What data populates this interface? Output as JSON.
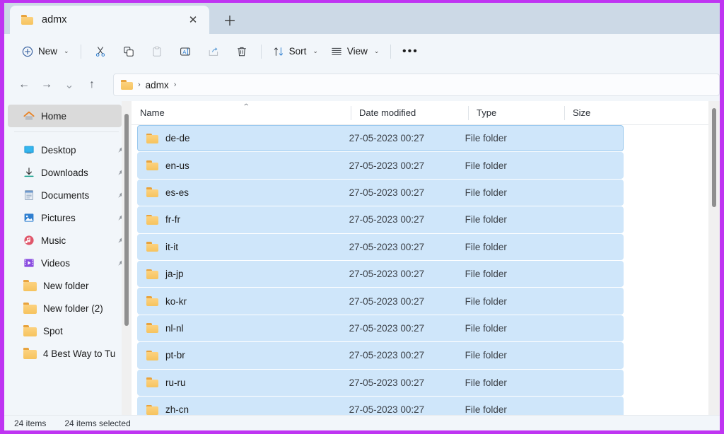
{
  "window": {
    "frame_color": "#bf34f2",
    "titlebar_color": "#ccd9e6",
    "accent_selection": "#cfe6fa"
  },
  "tabbar": {
    "tabs": [
      {
        "label": "admx",
        "icon": "folder-icon",
        "active": true
      }
    ],
    "close_glyph": "✕",
    "newtab_glyph": "＋",
    "newtab_label": "New tab"
  },
  "toolbar": {
    "new_label": "New",
    "new_glyph": "⊕",
    "chevron": "⌄",
    "cut_label": "Cut",
    "copy_label": "Copy",
    "paste_label": "Paste",
    "rename_label": "Rename",
    "share_label": "Share",
    "delete_label": "Delete",
    "sort_label": "Sort",
    "view_label": "View",
    "more_label": "See more",
    "more_glyph": "•••"
  },
  "navbar": {
    "back_glyph": "←",
    "forward_glyph": "→",
    "recent_glyph": "⌄",
    "up_glyph": "↑",
    "breadcrumb": {
      "icon": "folder-icon",
      "sep": "›",
      "items": [
        "admx"
      ],
      "trailing_sep": "›"
    }
  },
  "sidebar": {
    "home": {
      "label": "Home",
      "icon": "home-icon",
      "selected": true
    },
    "items": [
      {
        "label": "Desktop",
        "icon": "desktop-icon",
        "pinned": true
      },
      {
        "label": "Downloads",
        "icon": "download-icon",
        "pinned": true
      },
      {
        "label": "Documents",
        "icon": "document-icon",
        "pinned": true
      },
      {
        "label": "Pictures",
        "icon": "pictures-icon",
        "pinned": true
      },
      {
        "label": "Music",
        "icon": "music-icon",
        "pinned": true
      },
      {
        "label": "Videos",
        "icon": "video-icon",
        "pinned": true
      },
      {
        "label": "New folder",
        "icon": "folder-icon",
        "pinned": false
      },
      {
        "label": "New folder (2)",
        "icon": "folder-icon",
        "pinned": false
      },
      {
        "label": "Spot",
        "icon": "folder-icon",
        "pinned": false
      },
      {
        "label": "4 Best Way to Tu",
        "icon": "folder-icon",
        "pinned": false
      }
    ],
    "pin_glyph": "📌"
  },
  "filepane": {
    "columns": [
      {
        "key": "name",
        "label": "Name",
        "sorted": true,
        "sort_glyph": "⌃"
      },
      {
        "key": "date",
        "label": "Date modified"
      },
      {
        "key": "type",
        "label": "Type"
      },
      {
        "key": "size",
        "label": "Size"
      }
    ],
    "rows": [
      {
        "name": "de-de",
        "date": "27-05-2023 00:27",
        "type": "File folder",
        "size": "",
        "selected": true,
        "focused": true
      },
      {
        "name": "en-us",
        "date": "27-05-2023 00:27",
        "type": "File folder",
        "size": "",
        "selected": true,
        "focused": false
      },
      {
        "name": "es-es",
        "date": "27-05-2023 00:27",
        "type": "File folder",
        "size": "",
        "selected": true,
        "focused": false
      },
      {
        "name": "fr-fr",
        "date": "27-05-2023 00:27",
        "type": "File folder",
        "size": "",
        "selected": true,
        "focused": false
      },
      {
        "name": "it-it",
        "date": "27-05-2023 00:27",
        "type": "File folder",
        "size": "",
        "selected": true,
        "focused": false
      },
      {
        "name": "ja-jp",
        "date": "27-05-2023 00:27",
        "type": "File folder",
        "size": "",
        "selected": true,
        "focused": false
      },
      {
        "name": "ko-kr",
        "date": "27-05-2023 00:27",
        "type": "File folder",
        "size": "",
        "selected": true,
        "focused": false
      },
      {
        "name": "nl-nl",
        "date": "27-05-2023 00:27",
        "type": "File folder",
        "size": "",
        "selected": true,
        "focused": false
      },
      {
        "name": "pt-br",
        "date": "27-05-2023 00:27",
        "type": "File folder",
        "size": "",
        "selected": true,
        "focused": false
      },
      {
        "name": "ru-ru",
        "date": "27-05-2023 00:27",
        "type": "File folder",
        "size": "",
        "selected": true,
        "focused": false
      },
      {
        "name": "zh-cn",
        "date": "27-05-2023 00:27",
        "type": "File folder",
        "size": "",
        "selected": true,
        "focused": false
      }
    ]
  },
  "statusbar": {
    "item_count": "24 items",
    "selected_count": "24 items selected"
  }
}
